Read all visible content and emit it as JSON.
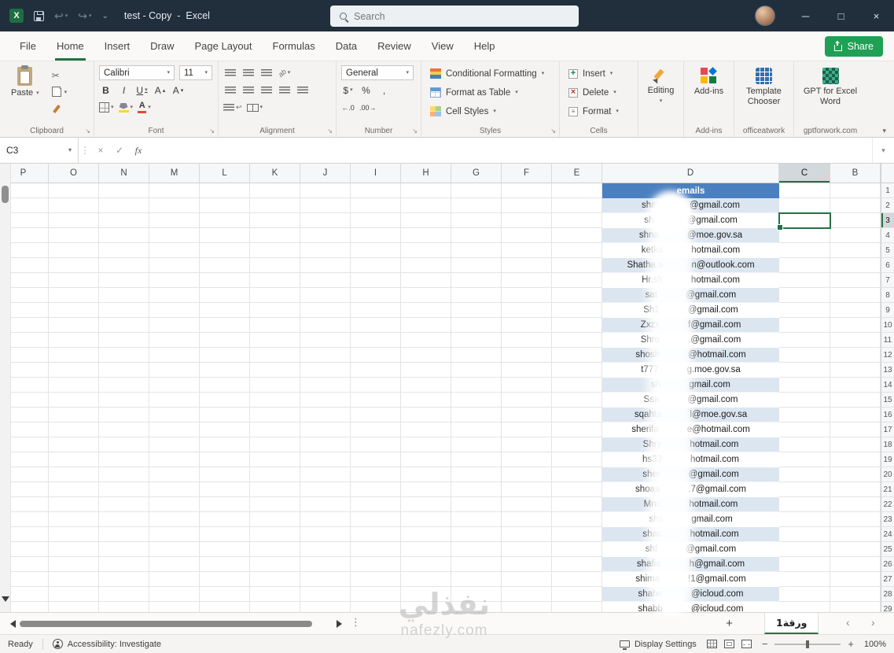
{
  "titlebar": {
    "title": "test - Copy  -  Excel",
    "search_placeholder": "Search"
  },
  "menu": {
    "tabs": [
      "File",
      "Home",
      "Insert",
      "Draw",
      "Page Layout",
      "Formulas",
      "Data",
      "Review",
      "View",
      "Help"
    ],
    "active_tab": "Home",
    "share": "Share"
  },
  "ribbon": {
    "paste": "Paste",
    "font": {
      "name": "Calibri",
      "size": "11"
    },
    "number_format": "General",
    "styles_items": [
      "Conditional Formatting",
      "Format as Table",
      "Cell Styles"
    ],
    "cells_items": [
      "Insert",
      "Delete",
      "Format"
    ],
    "editing": "Editing",
    "addins": "Add-ins",
    "template_chooser": "Template Chooser",
    "gpt": "GPT for Excel Word",
    "groups": {
      "clipboard": "Clipboard",
      "font": "Font",
      "alignment": "Alignment",
      "number": "Number",
      "styles": "Styles",
      "cells": "Cells",
      "addins": "Add-ins",
      "officeatwork": "officeatwork",
      "gptforwork": "gptforwork.com"
    }
  },
  "formula_bar": {
    "name_box": "C3",
    "fx_label": "fx",
    "value": ""
  },
  "sheet": {
    "columns": [
      "P",
      "O",
      "N",
      "M",
      "L",
      "K",
      "J",
      "I",
      "H",
      "G",
      "F",
      "E",
      "D",
      "C",
      "B"
    ],
    "selected_column": "C",
    "selected_row": 3,
    "visible_rows": 29,
    "table": {
      "header": "emails",
      "rows": [
        {
          "l": "shah",
          "r": "@gmail.com"
        },
        {
          "l": "sha",
          "r": "@gmail.com"
        },
        {
          "l": "shna",
          "r": "@moe.gov.sa"
        },
        {
          "l": "ketka",
          "r": "hotmail.com"
        },
        {
          "l": "Shatha.a",
          "r": "n@outlook.com"
        },
        {
          "l": "Hr.sh",
          "r": "hotmail.com"
        },
        {
          "l": "sat",
          "r": "@gmail.com"
        },
        {
          "l": "Sh1",
          "r": "@gmail.com"
        },
        {
          "l": "Zxzx",
          "r": "f@gmail.com"
        },
        {
          "l": "Shro",
          "r": ".@gmail.com"
        },
        {
          "l": "shosh",
          "r": "@hotmail.com"
        },
        {
          "l": "t777",
          "r": "g.moe.gov.sa"
        },
        {
          "l": "sh",
          "r": "gmail.com"
        },
        {
          "l": "Ssa",
          "r": "@gmail.com"
        },
        {
          "l": "sqahta",
          "r": "l@moe.gov.sa"
        },
        {
          "l": "sherifa",
          "r": "e@hotmail.com"
        },
        {
          "l": "Shry",
          "r": "hotmail.com"
        },
        {
          "l": "hs33",
          "r": "hotmail.com"
        },
        {
          "l": "sher",
          "r": "@gmail.com"
        },
        {
          "l": "shoaa",
          "r": ".7@gmail.com"
        },
        {
          "l": "Mnc",
          "r": "hotmail.com"
        },
        {
          "l": "shs",
          "r": "gmail.com"
        },
        {
          "l": "shac",
          "r": "hotmail.com"
        },
        {
          "l": "shf",
          "r": "@gmail.com"
        },
        {
          "l": "shafia",
          "r": "h@gmail.com"
        },
        {
          "l": "shima",
          "r": "!1@gmail.com"
        },
        {
          "l": "shahe",
          "r": "@icloud.com"
        },
        {
          "l": "shabb",
          "r": "@icloud.com"
        }
      ]
    }
  },
  "tabs_bar": {
    "sheet_name": "ورقة1",
    "add_sheet": "+"
  },
  "status_bar": {
    "mode": "Ready",
    "accessibility": "Accessibility: Investigate",
    "display_settings": "Display Settings",
    "zoom_level": "100%"
  },
  "watermark": {
    "title": "نفذلي",
    "domain": "nafezly.com"
  },
  "colors": {
    "accent_green": "#217346",
    "share_green": "#1fa055",
    "titlebar": "#212e3c",
    "table_header_blue": "#4b80c0",
    "band_blue": "#dce6f1"
  }
}
